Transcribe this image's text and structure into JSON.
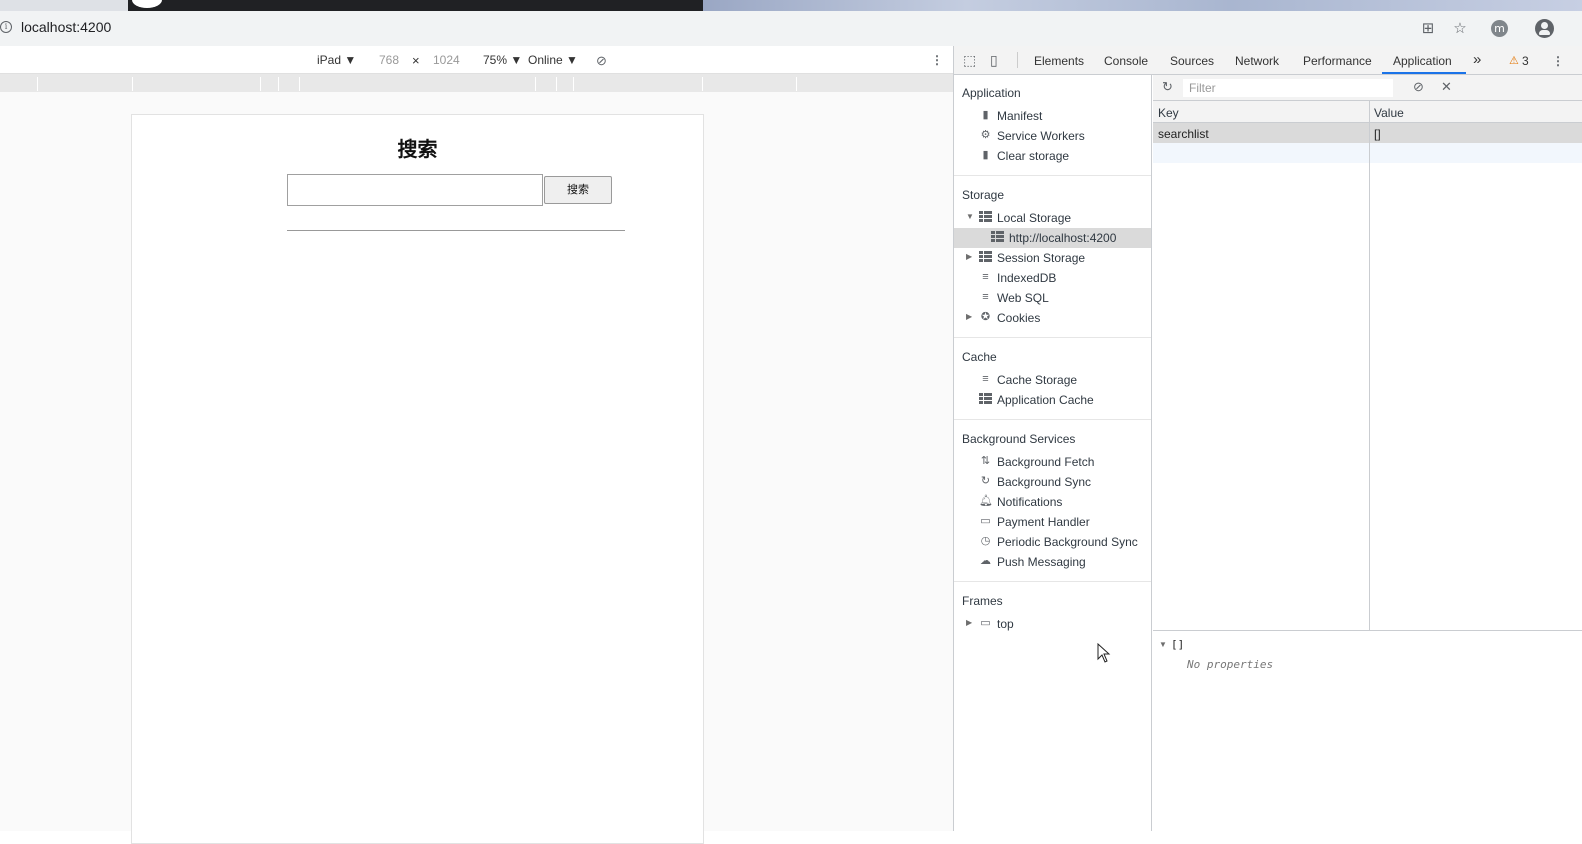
{
  "browser": {
    "url": "localhost:4200",
    "profile_initial": "m"
  },
  "emulation": {
    "device": "iPad ▼",
    "width": "768",
    "times": "×",
    "height": "1024",
    "zoom": "75% ▼",
    "network": "Online ▼"
  },
  "page": {
    "heading": "搜索",
    "search_button": "搜索",
    "search_value": ""
  },
  "devtools": {
    "tabs": [
      "Elements",
      "Console",
      "Sources",
      "Network",
      "Performance",
      "Application"
    ],
    "more_tabs": "»",
    "warning_count": "3",
    "sidebar": {
      "application_title": "Application",
      "application_items": [
        "Manifest",
        "Service Workers",
        "Clear storage"
      ],
      "storage_title": "Storage",
      "storage_items": [
        "Local Storage",
        "http://localhost:4200",
        "Session Storage",
        "IndexedDB",
        "Web SQL",
        "Cookies"
      ],
      "cache_title": "Cache",
      "cache_items": [
        "Cache Storage",
        "Application Cache"
      ],
      "background_title": "Background Services",
      "background_items": [
        "Background Fetch",
        "Background Sync",
        "Notifications",
        "Payment Handler",
        "Periodic Background Sync",
        "Push Messaging"
      ],
      "frames_title": "Frames",
      "frames_items": [
        "top"
      ]
    },
    "filter_placeholder": "Filter",
    "table": {
      "headers": [
        "Key",
        "Value"
      ],
      "rows": [
        {
          "key": "searchlist",
          "value": "[]"
        }
      ]
    },
    "preview": {
      "object": "[]",
      "note": "No properties"
    }
  },
  "colors": {
    "accent": "#1a73e8",
    "selected_row": "#dadada"
  }
}
